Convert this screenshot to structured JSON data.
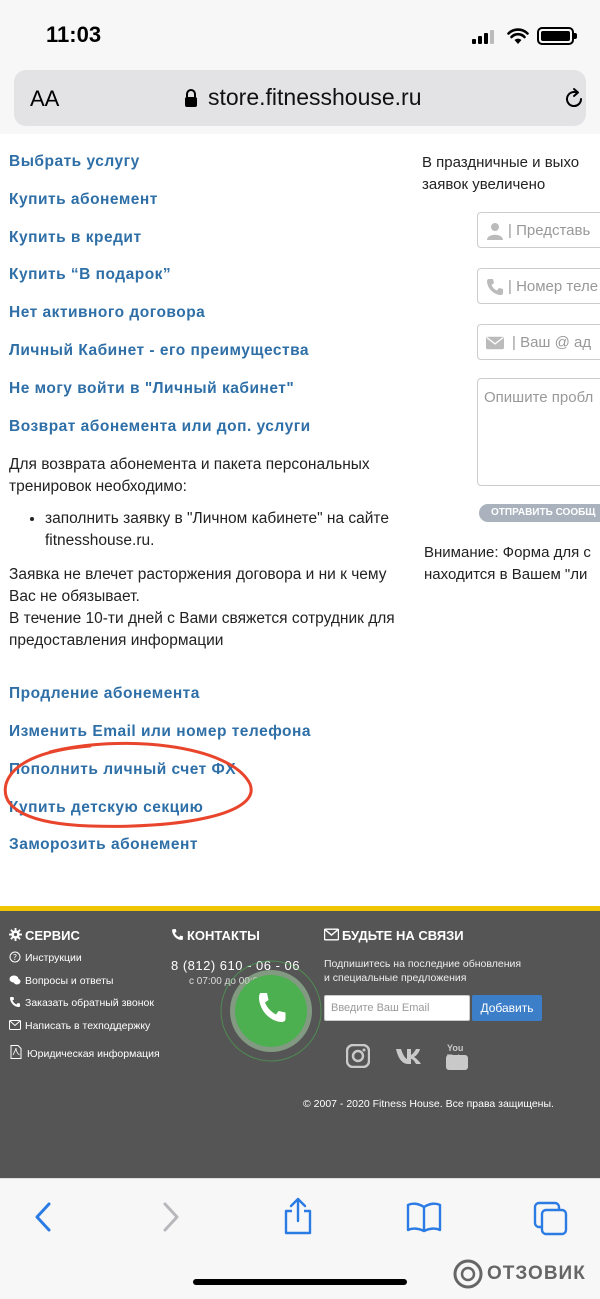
{
  "status_bar": {
    "time": "11:03"
  },
  "browser": {
    "text_size_label": "AA",
    "url": "store.fitnesshouse.ru"
  },
  "links": [
    "Выбрать услугу",
    "Купить абонемент",
    "Купить в кредит",
    "Купить “В подарок”",
    "Нет активного договора",
    "Личный Кабинет - его преимущества",
    "Не могу войти в \"Личный кабинет\"",
    "Возврат абонемента или доп. услуги"
  ],
  "refund": {
    "intro": "Для возврата абонемента и пакета персональных тренировок необходимо:",
    "bullet": "заполнить заявку в \"Личном кабинете\" на сайте fitnesshouse.ru.",
    "note1": "Заявка не влечет расторжения договора и ни к чему Вас не обязывает.",
    "note2": "В течение 10-ти дней с Вами свяжется сотрудник для предоставления информации"
  },
  "links_after": [
    "Продление абонемента",
    "Изменить Email или номер телефона",
    "Пополнить личный счет ФХ",
    "Купить детскую секцию",
    "Заморозить абонемент"
  ],
  "form": {
    "notice_line1": "В праздничные и выхо",
    "notice_line2": "заявок увеличено",
    "name_placeholder": "| Представь",
    "phone_placeholder": "| Номер теле",
    "email_placeholder": "| Ваш @ ад",
    "message_placeholder": "Опишите пробл",
    "send_label": "ОТПРАВИТЬ СООБЩ",
    "warning_line1": "Внимание: Форма для с",
    "warning_line2": "находится в Вашем \"ли"
  },
  "footer": {
    "service_title": "СЕРВИС",
    "service_items": [
      "Инструкции",
      "Вопросы и ответы",
      "Заказать обратный звонок",
      "Написать в техподдержку",
      "Юридическая информация"
    ],
    "contacts_title": "КОНТАКТЫ",
    "phone": "8 (812) 610 - 06 - 06",
    "hours": "с 07:00 до 00:00",
    "stay_title": "БУДЬТЕ НА СВЯЗИ",
    "subscribe_line1": "Подпишитесь на последние обновления",
    "subscribe_line2": "и специальные предложения",
    "email_placeholder": "Введите Ваш Email",
    "add_label": "Добавить",
    "youtube_label": "You Tube",
    "copyright": "© 2007 - 2020 Fitness House. Все права защищены."
  },
  "watermark": "ОТЗОВИК",
  "colors": {
    "link": "#2f6fa7",
    "footer_bg": "#555556",
    "accent_yellow": "#efc400",
    "add_button": "#3d7ec8",
    "call_green": "#4caf50",
    "annotation": "#e8452c",
    "safari_blue": "#2a7be4"
  }
}
